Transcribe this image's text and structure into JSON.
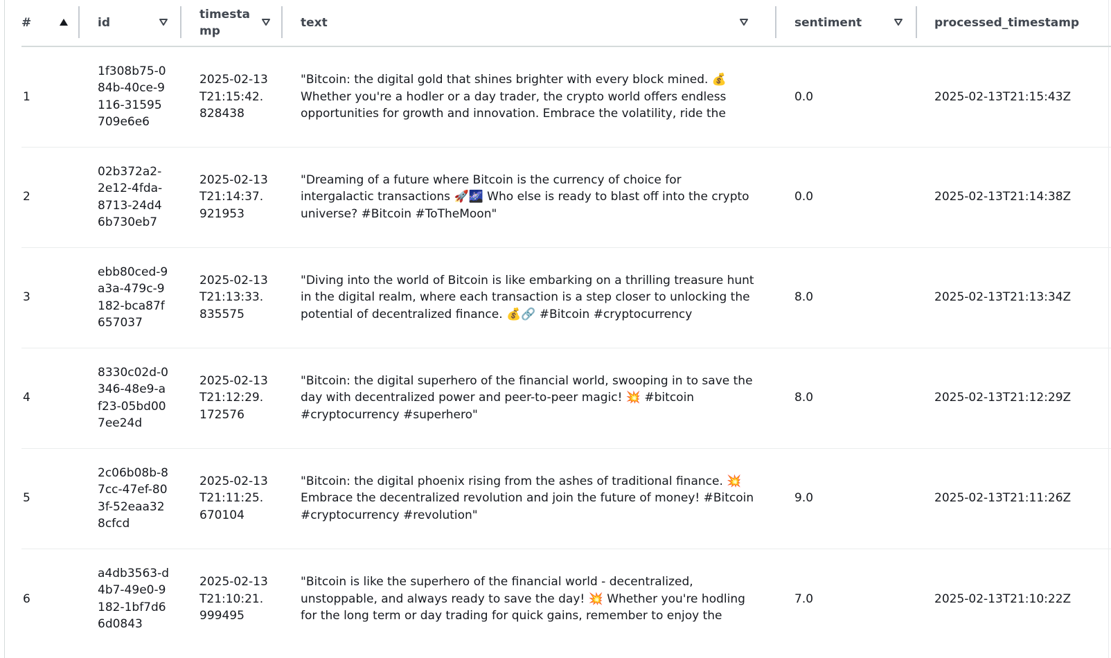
{
  "columns": {
    "num": "#",
    "id": "id",
    "timestamp": "timestamp",
    "text": "text",
    "sentiment": "sentiment",
    "processed_timestamp": "processed_timestamp"
  },
  "icons": {
    "sort_ascending": "triangle-up-icon",
    "sort_neutral": "triangle-down-outline-icon"
  },
  "colors": {
    "header_text": "#414750",
    "body_text": "#16191f",
    "divider": "#c6cbd1",
    "row_border": "#eaeded"
  },
  "rows": [
    {
      "num": "1",
      "id": "1f308b75-084b-40ce-9116-31595709e6e6",
      "timestamp": "2025-02-13T21:15:42.828438",
      "text": "\"Bitcoin: the digital gold that shines brighter with every block mined. 💰 Whether you're a hodler or a day trader, the crypto world offers endless opportunities for growth and innovation. Embrace the volatility, ride the waves, and remember that",
      "sentiment": "0.0",
      "processed_timestamp": "2025-02-13T21:15:43Z"
    },
    {
      "num": "2",
      "id": "02b372a2-2e12-4fda-8713-24d46b730eb7",
      "timestamp": "2025-02-13T21:14:37.921953",
      "text": "\"Dreaming of a future where Bitcoin is the currency of choice for intergalactic transactions 🚀🌌 Who else is ready to blast off into the crypto universe? #Bitcoin #ToTheMoon\"",
      "sentiment": "0.0",
      "processed_timestamp": "2025-02-13T21:14:38Z"
    },
    {
      "num": "3",
      "id": "ebb80ced-9a3a-479c-9182-bca87f657037",
      "timestamp": "2025-02-13T21:13:33.835575",
      "text": "\"Diving into the world of Bitcoin is like embarking on a thrilling treasure hunt in the digital realm, where each transaction is a step closer to unlocking the potential of decentralized finance. 💰🔗 #Bitcoin #cryptocurrency #innovation\"",
      "sentiment": "8.0",
      "processed_timestamp": "2025-02-13T21:13:34Z"
    },
    {
      "num": "4",
      "id": "8330c02d-0346-48e9-af23-05bd007ee24d",
      "timestamp": "2025-02-13T21:12:29.172576",
      "text": "\"Bitcoin: the digital superhero of the financial world, swooping in to save the day with decentralized power and peer-to-peer magic! 💥 #bitcoin #cryptocurrency #superhero\"",
      "sentiment": "8.0",
      "processed_timestamp": "2025-02-13T21:12:29Z"
    },
    {
      "num": "5",
      "id": "2c06b08b-87cc-47ef-803f-52eaa328cfcd",
      "timestamp": "2025-02-13T21:11:25.670104",
      "text": "\"Bitcoin: the digital phoenix rising from the ashes of traditional finance. 💥 Embrace the decentralized revolution and join the future of money! #Bitcoin #cryptocurrency #revolution\"",
      "sentiment": "9.0",
      "processed_timestamp": "2025-02-13T21:11:26Z"
    },
    {
      "num": "6",
      "id": "a4db3563-d4b7-49e0-9182-1bf7d66d0843",
      "timestamp": "2025-02-13T21:10:21.999495",
      "text": "\"Bitcoin is like the superhero of the financial world - decentralized, unstoppable, and always ready to save the day! 💥 Whether you're hodling for the long term or day trading for quick gains, remember to enjoy the rollercoaster ride of",
      "sentiment": "7.0",
      "processed_timestamp": "2025-02-13T21:10:22Z"
    }
  ]
}
